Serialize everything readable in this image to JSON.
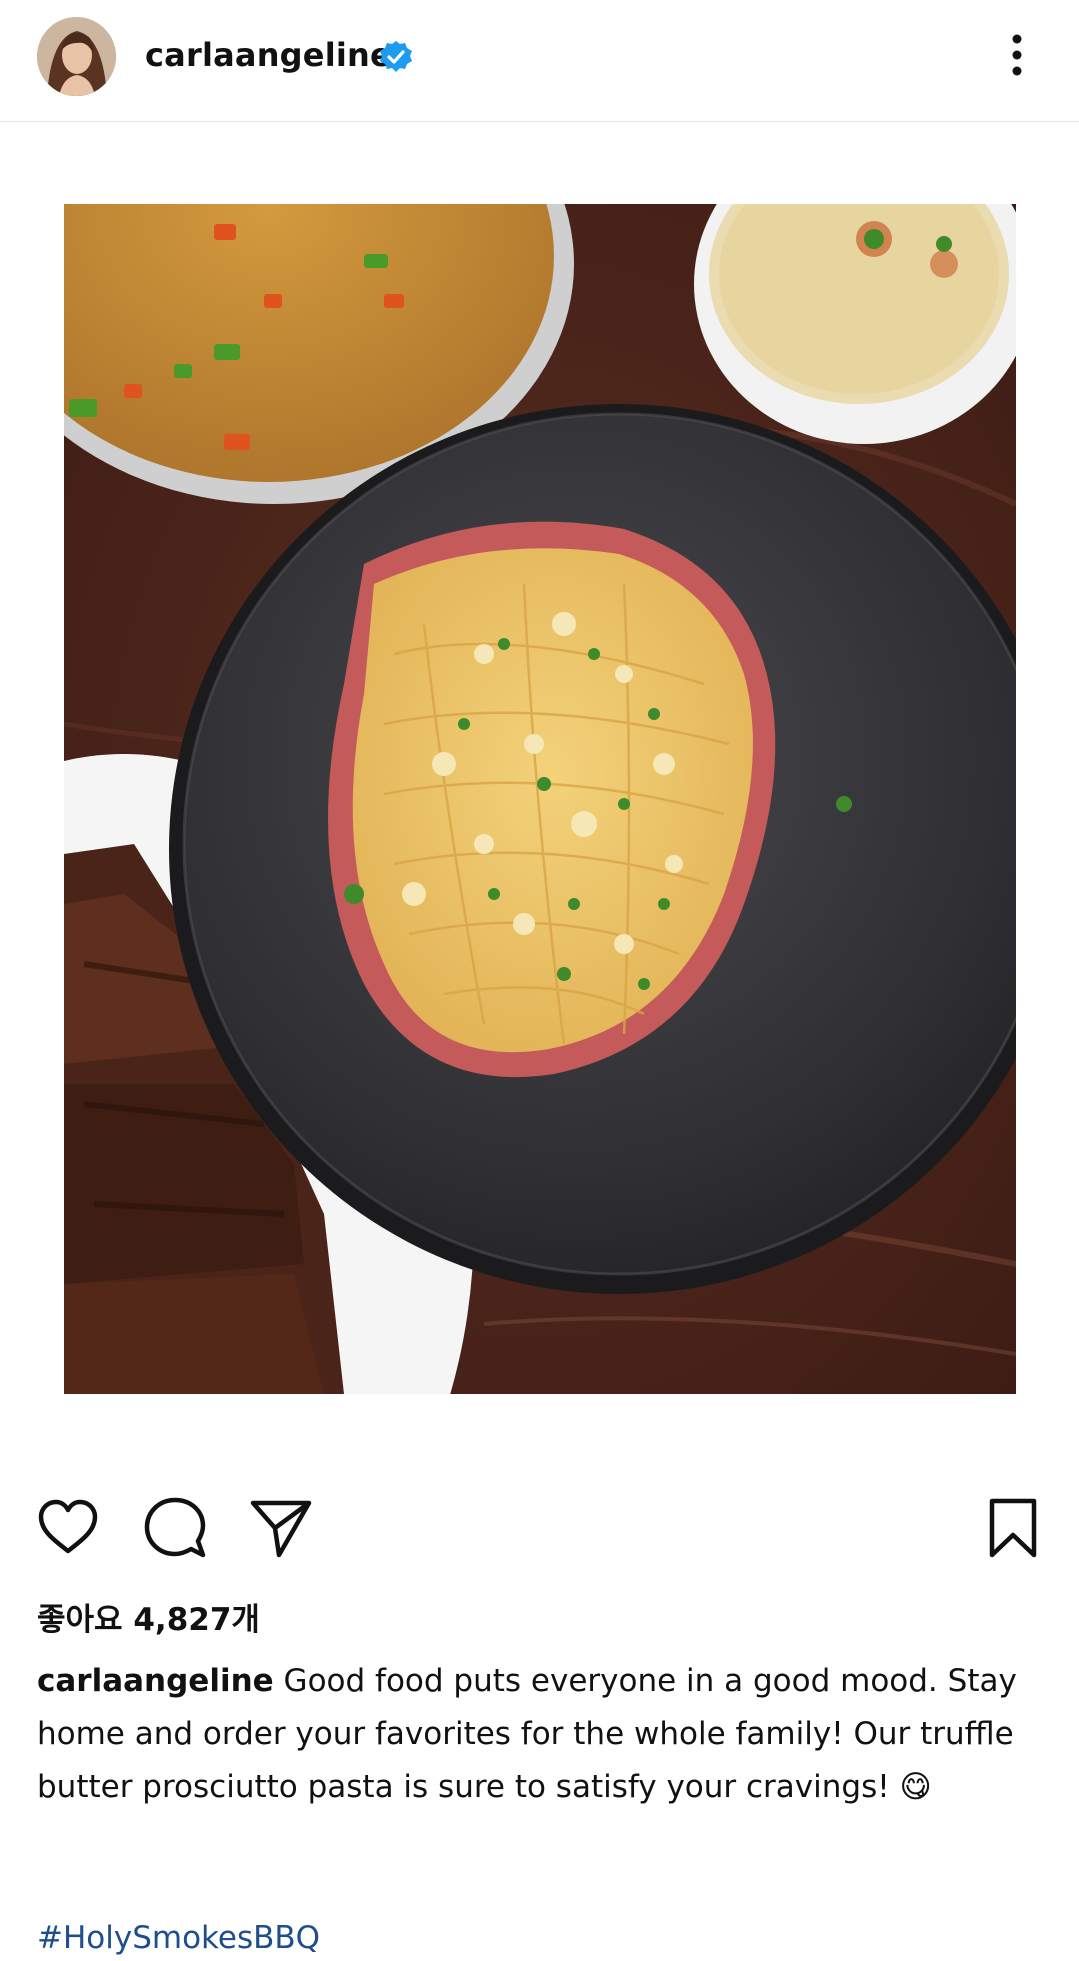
{
  "post": {
    "username": "carlaangeline",
    "likes_text": "좋아요 4,827개",
    "caption": {
      "username": "carlaangeline",
      "text": "Good food puts everyone in a good mood.  Stay home and order your favorites for the whole family! Our truffle butter prosciutto pasta is sure to satisfy your cravings! 😋"
    },
    "hashtag": "#HolySmokesBBQ"
  },
  "icons": {
    "verified": "verified-badge-icon",
    "more": "more-vertical-icon",
    "like": "heart-icon",
    "comment": "comment-icon",
    "share": "send-icon",
    "save": "bookmark-icon"
  },
  "colors": {
    "verified_blue": "#1d9bf0",
    "hashtag": "#1f4e8c",
    "divider": "#e3e3e3"
  }
}
